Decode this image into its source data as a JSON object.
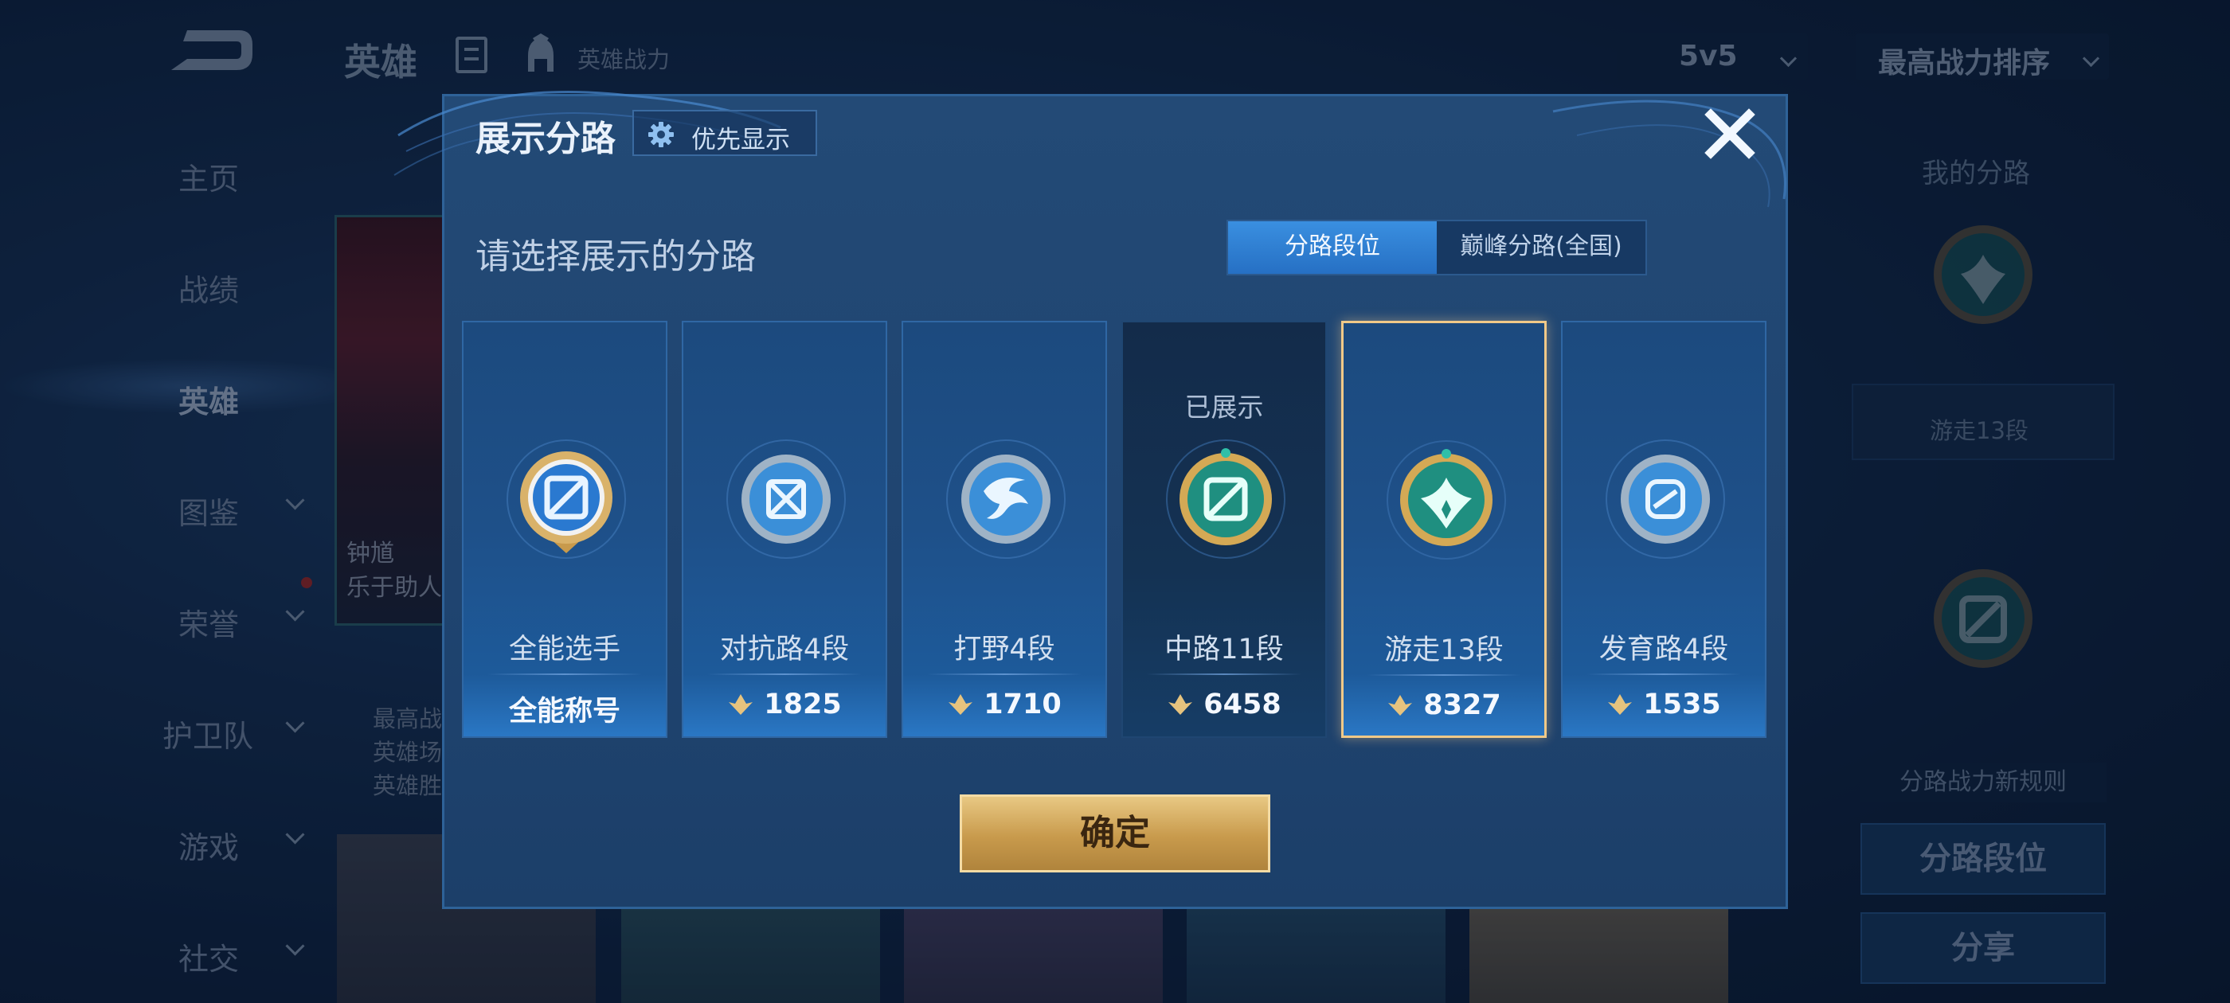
{
  "header": {
    "title": "英雄",
    "power_label": "英雄战力",
    "mode_select": "5v5",
    "sort_select": "最高战力排序"
  },
  "nav": {
    "items": [
      {
        "label": "主页",
        "has_chevron": false
      },
      {
        "label": "战绩",
        "has_chevron": false
      },
      {
        "label": "英雄",
        "has_chevron": false,
        "active": true
      },
      {
        "label": "图鉴",
        "has_chevron": true
      },
      {
        "label": "荣誉",
        "has_chevron": true
      },
      {
        "label": "护卫队",
        "has_chevron": true
      },
      {
        "label": "游戏",
        "has_chevron": true
      },
      {
        "label": "社交",
        "has_chevron": true
      }
    ]
  },
  "hero_card": {
    "name": "钟馗",
    "desc": "乐于助人",
    "info": [
      "最高战",
      "英雄场",
      "英雄胜"
    ]
  },
  "right_panel": {
    "title": "我的分路",
    "current_lane": "游走13段",
    "rule_label": "分路战力新规则",
    "lane_rank_button": "分路段位",
    "share_button": "分享"
  },
  "dialog": {
    "title": "展示分路",
    "priority_button": "优先显示",
    "subtitle": "请选择展示的分路",
    "tabs": [
      {
        "label": "分路段位",
        "active": true
      },
      {
        "label": "巅峰分路(全国)",
        "active": false
      }
    ],
    "lanes": [
      {
        "name": "全能选手",
        "value": "全能称号",
        "emblem": "all-round-emblem",
        "shown": false,
        "selected": false,
        "show_power_icon": false
      },
      {
        "name": "对抗路4段",
        "value": "1825",
        "emblem": "clash-lane-emblem",
        "shown": false,
        "selected": false,
        "show_power_icon": true
      },
      {
        "name": "打野4段",
        "value": "1710",
        "emblem": "jungle-emblem",
        "shown": false,
        "selected": false,
        "show_power_icon": true
      },
      {
        "name": "中路11段",
        "value": "6458",
        "emblem": "mid-lane-emblem",
        "shown": true,
        "shown_label": "已展示",
        "selected": false,
        "show_power_icon": true
      },
      {
        "name": "游走13段",
        "value": "8327",
        "emblem": "roam-emblem",
        "shown": false,
        "selected": true,
        "show_power_icon": true
      },
      {
        "name": "发育路4段",
        "value": "1535",
        "emblem": "farm-lane-emblem",
        "shown": false,
        "selected": false,
        "show_power_icon": true
      }
    ],
    "confirm_button": "确定"
  },
  "colors": {
    "accent_gold": "#f0c988",
    "tab_active": "#2f7fd4",
    "dialog_bg": "#214873"
  }
}
